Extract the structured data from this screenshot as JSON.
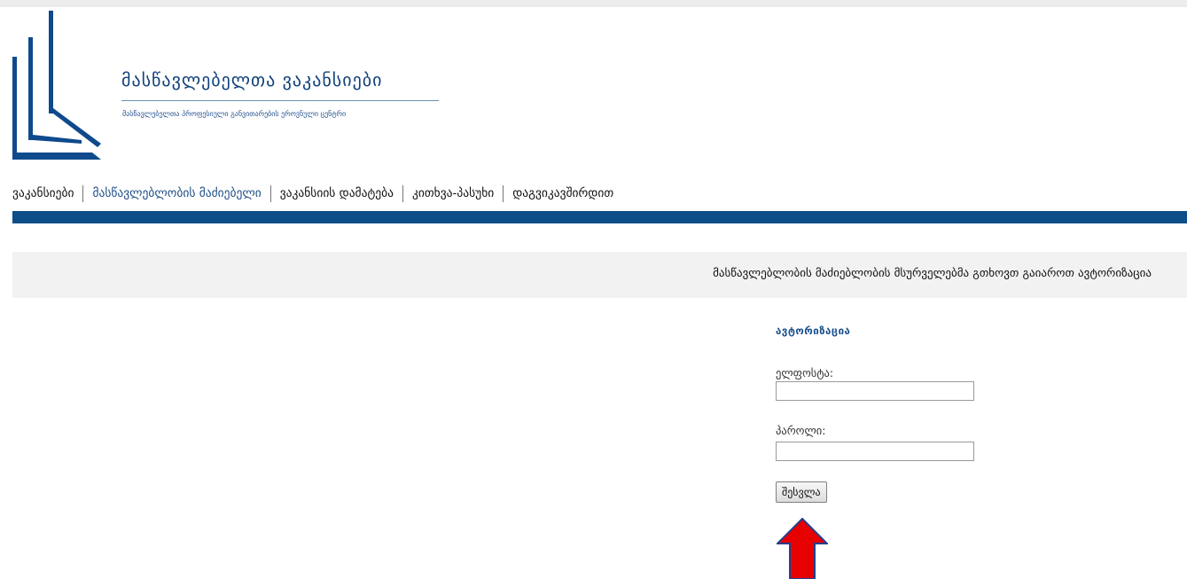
{
  "header": {
    "site_title": "მასწავლებელთა ვაკანსიები",
    "site_subtitle": "მასწავლებელთა პროფესიული განვითარების ეროვნული ცენტრი",
    "logo_icon": "logo-icon"
  },
  "nav": {
    "items": [
      {
        "label": "ვაკანსიები"
      },
      {
        "label": "მასწავლებლობის მაძიებელი"
      },
      {
        "label": "ვაკანსიის დამატება"
      },
      {
        "label": "კითხვა-პასუხი"
      },
      {
        "label": "დაგვიკავშირდით"
      }
    ]
  },
  "notice": {
    "text": "მასწავლებლობის მაძიებლობის მსურველებმა გთხოვთ გაიაროთ ავტორიზაცია"
  },
  "login": {
    "heading": "ავტორიზაცია",
    "email_label": "ელფოსტა:",
    "email_value": "",
    "password_label": "პაროლი:",
    "password_value": "",
    "submit_label": "შესვლა"
  },
  "annotation": {
    "arrow_icon": "up-arrow-icon",
    "arrow_color": "#e60000"
  },
  "colors": {
    "brand": "#0d4d88",
    "title": "#10407a",
    "heading": "#174f8e"
  }
}
